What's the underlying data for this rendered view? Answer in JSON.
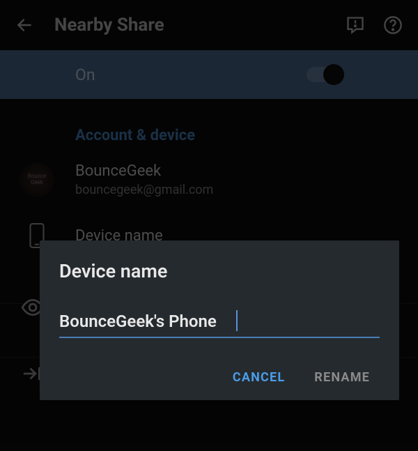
{
  "header": {
    "title": "Nearby Share"
  },
  "toggle": {
    "label": "On",
    "state": true
  },
  "section": {
    "title": "Account & device"
  },
  "account": {
    "name": "BounceGeek",
    "email": "bouncegeek@gmail.com",
    "avatar_text_1": "Bounce",
    "avatar_text_2": "Geek"
  },
  "device": {
    "label": "Device name"
  },
  "dialog": {
    "title": "Device name",
    "input_value": "BounceGeek's Phone",
    "cancel_label": "CANCEL",
    "rename_label": "RENAME"
  }
}
